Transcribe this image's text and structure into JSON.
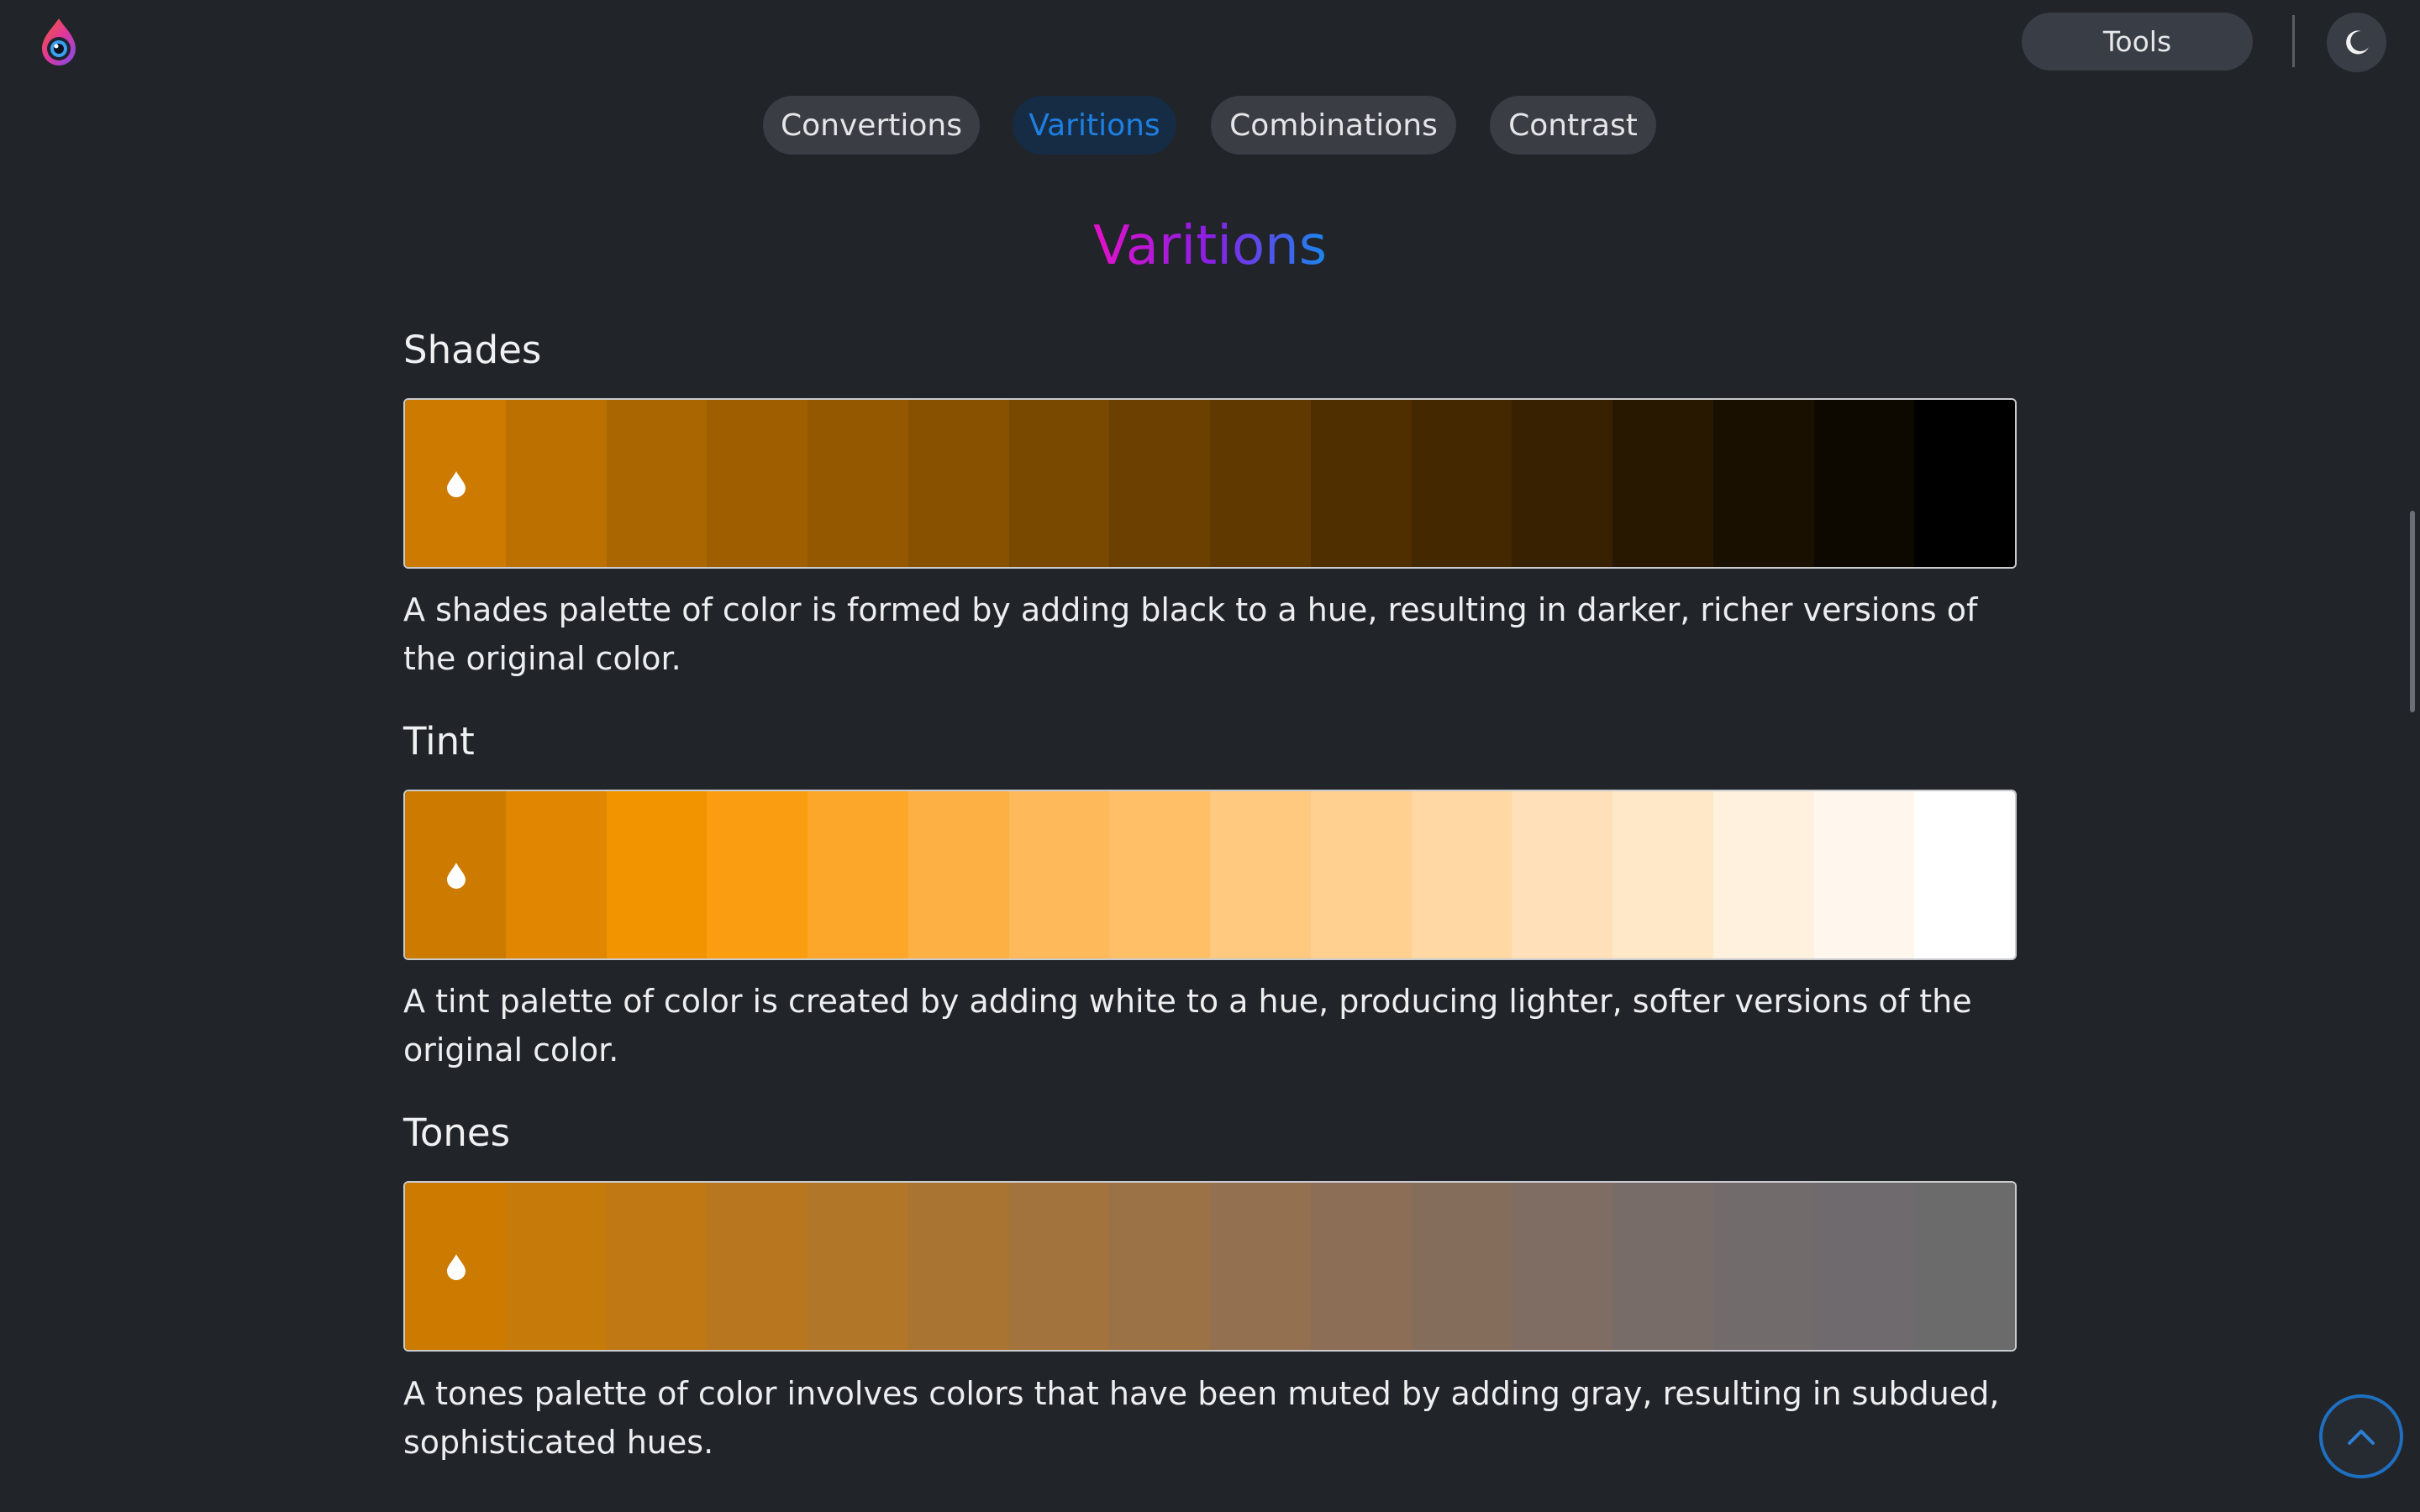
{
  "header": {
    "logo_icon": "eye-drop-logo-icon",
    "tools_label": "Tools",
    "theme_icon": "moon-icon"
  },
  "tabs": [
    {
      "label": "Convertions",
      "active": false
    },
    {
      "label": "Varitions",
      "active": true
    },
    {
      "label": "Combinations",
      "active": false
    },
    {
      "label": "Contrast",
      "active": false
    }
  ],
  "page_title": "Varitions",
  "sections": {
    "shades": {
      "title": "Shades",
      "description": "A shades palette of color is formed by adding black to a hue, resulting in darker, richer versions of the original color.",
      "colors": [
        "#cc7a00",
        "#bb7000",
        "#aa6600",
        "#9f5f00",
        "#935800",
        "#885100",
        "#794900",
        "#6b4000",
        "#603900",
        "#4f2f00",
        "#432800",
        "#372100",
        "#291800",
        "#1a1000",
        "#0d0800",
        "#000000"
      ]
    },
    "tint": {
      "title": "Tint",
      "description": "A tint palette of color is created by adding white to a hue, producing lighter, softer versions of the original color.",
      "colors": [
        "#cc7a00",
        "#e08600",
        "#f29300",
        "#fb9d10",
        "#fca72a",
        "#fdb044",
        "#feb95a",
        "#ffbf66",
        "#ffc980",
        "#ffd08f",
        "#ffd8a3",
        "#ffe0b8",
        "#ffe8c8",
        "#fff1dd",
        "#fff7ee",
        "#ffffff"
      ]
    },
    "tones": {
      "title": "Tones",
      "description": "A tones palette of color involves colors that have been muted by adding gray, resulting in subdued, sophisticated hues.",
      "colors": [
        "#cc7a00",
        "#c67a0a",
        "#bf7814",
        "#b8771f",
        "#b17628",
        "#a97432",
        "#a2733c",
        "#9b7246",
        "#937050",
        "#8c6e56",
        "#856d5c",
        "#7f6c62",
        "#786c68",
        "#726b6c",
        "#6e6a6e",
        "#6b6b6b"
      ]
    }
  },
  "scroll_top_icon": "chevron-up-icon"
}
